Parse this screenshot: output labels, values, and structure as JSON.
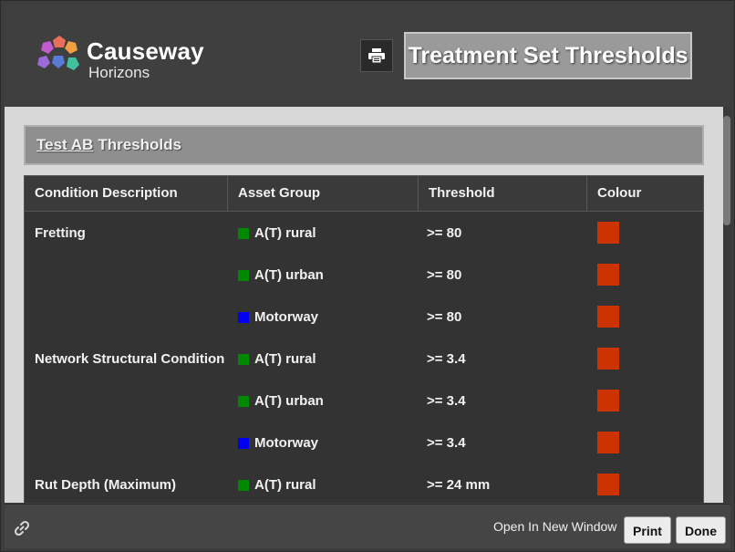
{
  "logo": {
    "name": "Causeway",
    "sub": "Horizons"
  },
  "header": {
    "title": "Treatment Set Thresholds",
    "print_icon": "printer-icon"
  },
  "section": {
    "link_text": "Test AB",
    "rest_text": "Thresholds"
  },
  "table": {
    "columns": [
      "Condition Description",
      "Asset Group",
      "Threshold",
      "Colour"
    ],
    "rows": [
      {
        "condition": "Fretting",
        "asset_group": "A(T) rural",
        "asset_color": "#008800",
        "threshold": ">= 80",
        "colour": "#cc3300"
      },
      {
        "condition": "",
        "asset_group": "A(T) urban",
        "asset_color": "#008800",
        "threshold": ">= 80",
        "colour": "#cc3300"
      },
      {
        "condition": "",
        "asset_group": "Motorway",
        "asset_color": "#0000ee",
        "threshold": ">= 80",
        "colour": "#cc3300"
      },
      {
        "condition": "Network Structural Condition",
        "asset_group": "A(T) rural",
        "asset_color": "#008800",
        "threshold": ">= 3.4",
        "colour": "#cc3300"
      },
      {
        "condition": "",
        "asset_group": "A(T) urban",
        "asset_color": "#008800",
        "threshold": ">= 3.4",
        "colour": "#cc3300"
      },
      {
        "condition": "",
        "asset_group": "Motorway",
        "asset_color": "#0000ee",
        "threshold": ">= 3.4",
        "colour": "#cc3300"
      },
      {
        "condition": "Rut Depth (Maximum)",
        "asset_group": "A(T) rural",
        "asset_color": "#008800",
        "threshold": ">= 24 mm",
        "colour": "#cc3300"
      }
    ]
  },
  "footer": {
    "link_icon": "link-icon",
    "open_new_window": "Open In New Window",
    "print_label": "Print",
    "done_label": "Done"
  }
}
